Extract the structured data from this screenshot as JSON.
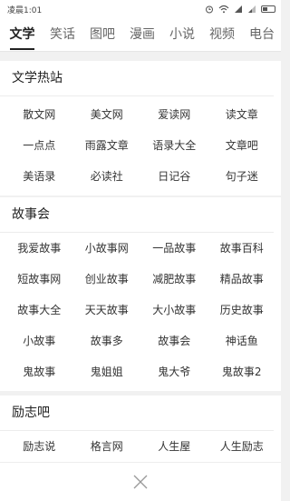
{
  "status_bar": {
    "time": "凌晨1:01",
    "icons": [
      "alarm-icon",
      "wifi-icon",
      "signal-icon",
      "signal-icon",
      "battery-icon"
    ]
  },
  "tabs": [
    {
      "label": "文学",
      "active": true
    },
    {
      "label": "笑话"
    },
    {
      "label": "图吧"
    },
    {
      "label": "漫画"
    },
    {
      "label": "小说"
    },
    {
      "label": "视频"
    },
    {
      "label": "电台"
    }
  ],
  "sections": [
    {
      "title": "文学热站",
      "items": [
        "散文网",
        "美文网",
        "爱读网",
        "读文章",
        "一点点",
        "雨露文章",
        "语录大全",
        "文章吧",
        "美语录",
        "必读社",
        "日记谷",
        "句子迷"
      ]
    },
    {
      "title": "故事会",
      "items": [
        "我爱故事",
        "小故事网",
        "一品故事",
        "故事百科",
        "短故事网",
        "创业故事",
        "减肥故事",
        "精品故事",
        "故事大全",
        "天天故事",
        "大小故事",
        "历史故事",
        "小故事",
        "故事多",
        "故事会",
        "神话鱼",
        "鬼故事",
        "鬼姐姐",
        "鬼大爷",
        "鬼故事2"
      ]
    },
    {
      "title": "励志吧",
      "items": [
        "励志说",
        "格言网",
        "人生屋",
        "人生励志"
      ]
    }
  ],
  "bottom_bar": {
    "close_icon": "close-icon"
  },
  "colors": {
    "active_tab": "#222222",
    "inactive_tab": "#666666",
    "background": "#f1f1f1"
  }
}
